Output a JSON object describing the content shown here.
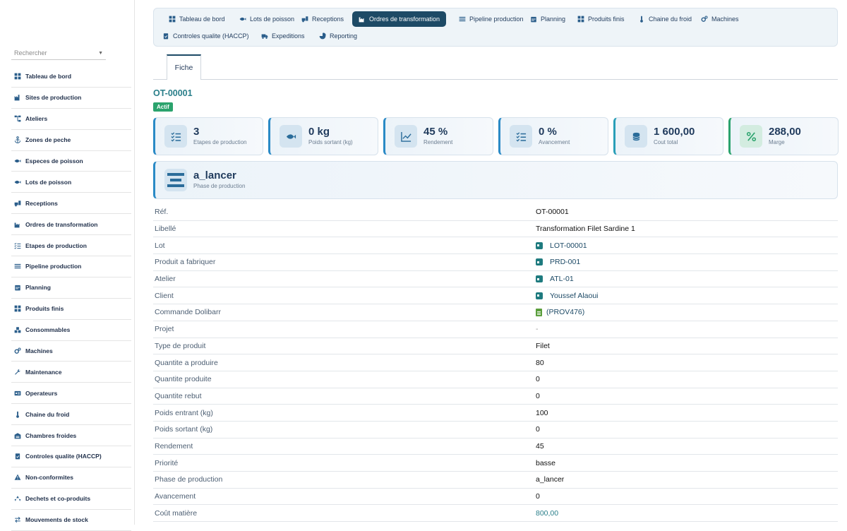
{
  "sidebar": {
    "search_placeholder": "Rechercher",
    "items": [
      {
        "label": "Tableau de bord",
        "icon": "grid-icon"
      },
      {
        "label": "Sites de production",
        "icon": "factory-icon"
      },
      {
        "label": "Ateliers",
        "icon": "sitemap-icon"
      },
      {
        "label": "Zones de peche",
        "icon": "anchor-icon"
      },
      {
        "label": "Especes de poisson",
        "icon": "fish-icon"
      },
      {
        "label": "Lots de poisson",
        "icon": "fish-icon"
      },
      {
        "label": "Receptions",
        "icon": "truck-loading-icon"
      },
      {
        "label": "Ordres de transformation",
        "icon": "industry-icon"
      },
      {
        "label": "Etapes de production",
        "icon": "list-check-icon"
      },
      {
        "label": "Pipeline production",
        "icon": "bars-icon"
      },
      {
        "label": "Planning",
        "icon": "calendar-icon"
      },
      {
        "label": "Produits finis",
        "icon": "grid-icon"
      },
      {
        "label": "Consommables",
        "icon": "boxes-icon"
      },
      {
        "label": "Machines",
        "icon": "cogs-icon"
      },
      {
        "label": "Maintenance",
        "icon": "wrench-icon"
      },
      {
        "label": "Operateurs",
        "icon": "id-card-icon"
      },
      {
        "label": "Chaine du froid",
        "icon": "thermometer-icon"
      },
      {
        "label": "Chambres froides",
        "icon": "warehouse-icon"
      },
      {
        "label": "Controles qualite (HACCP)",
        "icon": "clipboard-check-icon"
      },
      {
        "label": "Non-conformites",
        "icon": "warning-icon"
      },
      {
        "label": "Dechets et co-produits",
        "icon": "recycle-icon"
      },
      {
        "label": "Mouvements de stock",
        "icon": "exchange-icon"
      }
    ]
  },
  "topnav": [
    {
      "label": "Tableau de bord",
      "icon": "grid-icon"
    },
    {
      "label": "Lots de poisson",
      "icon": "fish-icon"
    },
    {
      "label": "Receptions",
      "icon": "truck-loading-icon"
    },
    {
      "label": "Ordres de transformation",
      "icon": "industry-icon",
      "active": true
    },
    {
      "label": "Pipeline production",
      "icon": "bars-icon"
    },
    {
      "label": "Planning",
      "icon": "calendar-icon"
    },
    {
      "label": "Produits finis",
      "icon": "grid-icon"
    },
    {
      "label": "Chaine du froid",
      "icon": "thermometer-icon"
    },
    {
      "label": "Machines",
      "icon": "cogs-icon"
    },
    {
      "label": "Controles qualite (HACCP)",
      "icon": "clipboard-check-icon"
    },
    {
      "label": "Expeditions",
      "icon": "truck-icon"
    },
    {
      "label": "Reporting",
      "icon": "pie-chart-icon"
    }
  ],
  "tabs": {
    "fiche": "Fiche"
  },
  "record": {
    "ref": "OT-00001",
    "status": "Actif"
  },
  "kpis": [
    {
      "value": "3",
      "label": "Etapes de production",
      "icon": "list-check-icon",
      "color": "#2a8ac6"
    },
    {
      "value": "0 kg",
      "label": "Poids sortant (kg)",
      "icon": "fish-icon",
      "color": "#2a8ac6"
    },
    {
      "value": "45 %",
      "label": "Rendement",
      "icon": "chart-line-icon",
      "color": "#2a8ac6"
    },
    {
      "value": "0 %",
      "label": "Avancement",
      "icon": "list-check-icon",
      "color": "#2a8ac6"
    },
    {
      "value": "1 600,00",
      "label": "Cout total",
      "icon": "coins-icon",
      "color": "#2a9fb8"
    },
    {
      "value": "288,00",
      "label": "Marge",
      "icon": "percent-icon",
      "color": "#2ba36d"
    }
  ],
  "phase": {
    "value": "a_lancer",
    "label": "Phase de production",
    "icon": "bars-icon"
  },
  "fields": [
    {
      "key": "Réf.",
      "value": "OT-00001",
      "type": "text"
    },
    {
      "key": "Libellé",
      "value": "Transformation Filet Sardine 1",
      "type": "text"
    },
    {
      "key": "Lot",
      "value": "LOT-00001",
      "type": "link"
    },
    {
      "key": "Produit a fabriquer",
      "value": "PRD-001",
      "type": "link"
    },
    {
      "key": "Atelier",
      "value": "ATL-01",
      "type": "link"
    },
    {
      "key": "Client",
      "value": "Youssef Alaoui",
      "type": "link"
    },
    {
      "key": "Commande Dolibarr",
      "value": "(PROV476)",
      "type": "doc"
    },
    {
      "key": "Projet",
      "value": "-",
      "type": "muted"
    },
    {
      "key": "Type de produit",
      "value": "Filet",
      "type": "text"
    },
    {
      "key": "Quantite a produire",
      "value": "80",
      "type": "text"
    },
    {
      "key": "Quantite produite",
      "value": "0",
      "type": "text"
    },
    {
      "key": "Quantite rebut",
      "value": "0",
      "type": "text"
    },
    {
      "key": "Poids entrant (kg)",
      "value": "100",
      "type": "text"
    },
    {
      "key": "Poids sortant (kg)",
      "value": "0",
      "type": "text"
    },
    {
      "key": "Rendement",
      "value": "45",
      "type": "text"
    },
    {
      "key": "Priorité",
      "value": "basse",
      "type": "text"
    },
    {
      "key": "Phase de production",
      "value": "a_lancer",
      "type": "text"
    },
    {
      "key": "Avancement",
      "value": "0",
      "type": "text"
    },
    {
      "key": "Coût matière",
      "value": "800,00",
      "type": "teal"
    }
  ]
}
